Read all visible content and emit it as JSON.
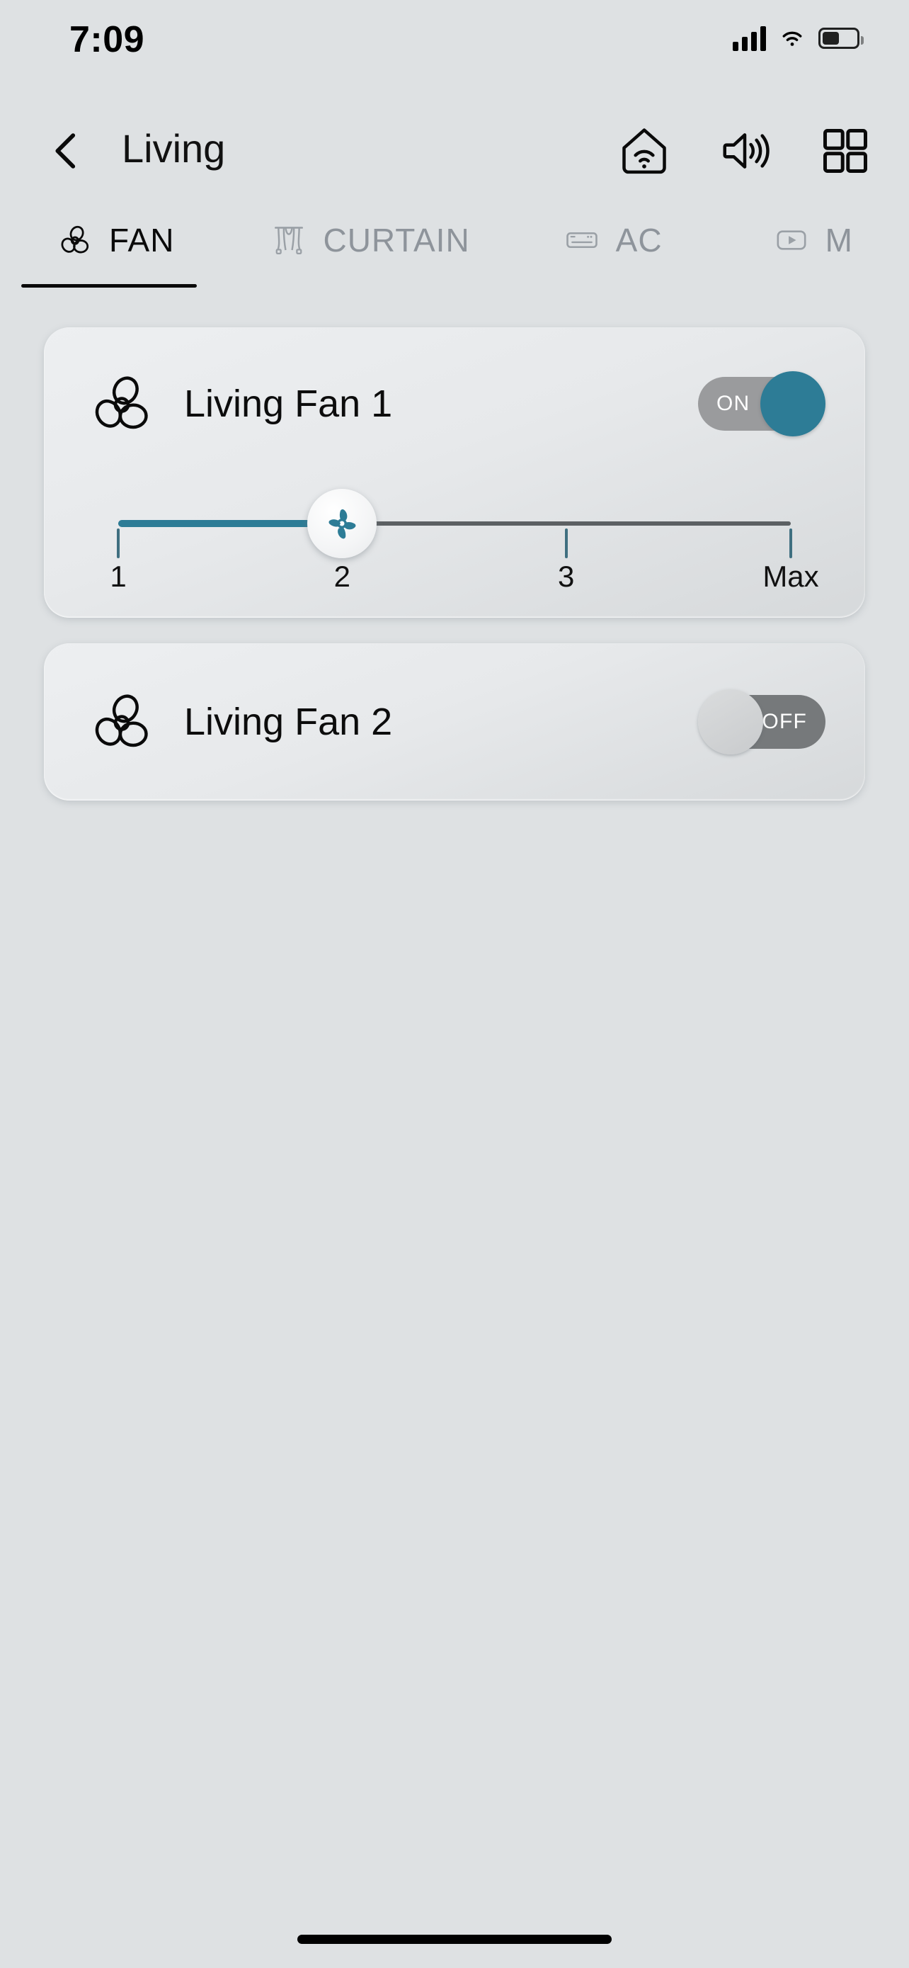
{
  "status_bar": {
    "time": "7:09",
    "signal_icon": "cellular-bars-icon",
    "wifi_icon": "wifi-icon",
    "battery_icon": "battery-icon",
    "battery_level_pct": 44
  },
  "nav_bar": {
    "back_icon": "chevron-left-icon",
    "title": "Living",
    "actions": [
      {
        "name": "home-wifi-icon",
        "label": "Home"
      },
      {
        "name": "speaker-volume-icon",
        "label": "Volume"
      },
      {
        "name": "grid-view-icon",
        "label": "Grid"
      }
    ]
  },
  "tabs": {
    "active_index": 0,
    "items": [
      {
        "label": "FAN",
        "icon": "fan-icon",
        "active": true
      },
      {
        "label": "CURTAIN",
        "icon": "curtain-icon",
        "active": false
      },
      {
        "label": "AC",
        "icon": "ac-unit-icon",
        "active": false
      },
      {
        "label": "M",
        "icon": "media-play-icon",
        "active": false
      }
    ]
  },
  "devices": [
    {
      "name": "Living Fan 1",
      "icon": "fan-icon",
      "toggle": {
        "state": "on",
        "label": "ON"
      },
      "speed_slider": {
        "value": 2,
        "min": 1,
        "max": 4,
        "ticks": [
          "1",
          "2",
          "3",
          "Max"
        ],
        "thumb_icon": "fan-blade-icon"
      }
    },
    {
      "name": "Living Fan 2",
      "icon": "fan-icon",
      "toggle": {
        "state": "off",
        "label": "OFF"
      }
    }
  ],
  "colors": {
    "background": "#dee1e3",
    "accent_teal": "#2d7c96",
    "toggle_on_track": "#9a9b9d",
    "toggle_off_track": "#76797b",
    "text_primary": "#0c0c0c",
    "text_muted": "#8e949b"
  },
  "home_indicator": "home-indicator"
}
